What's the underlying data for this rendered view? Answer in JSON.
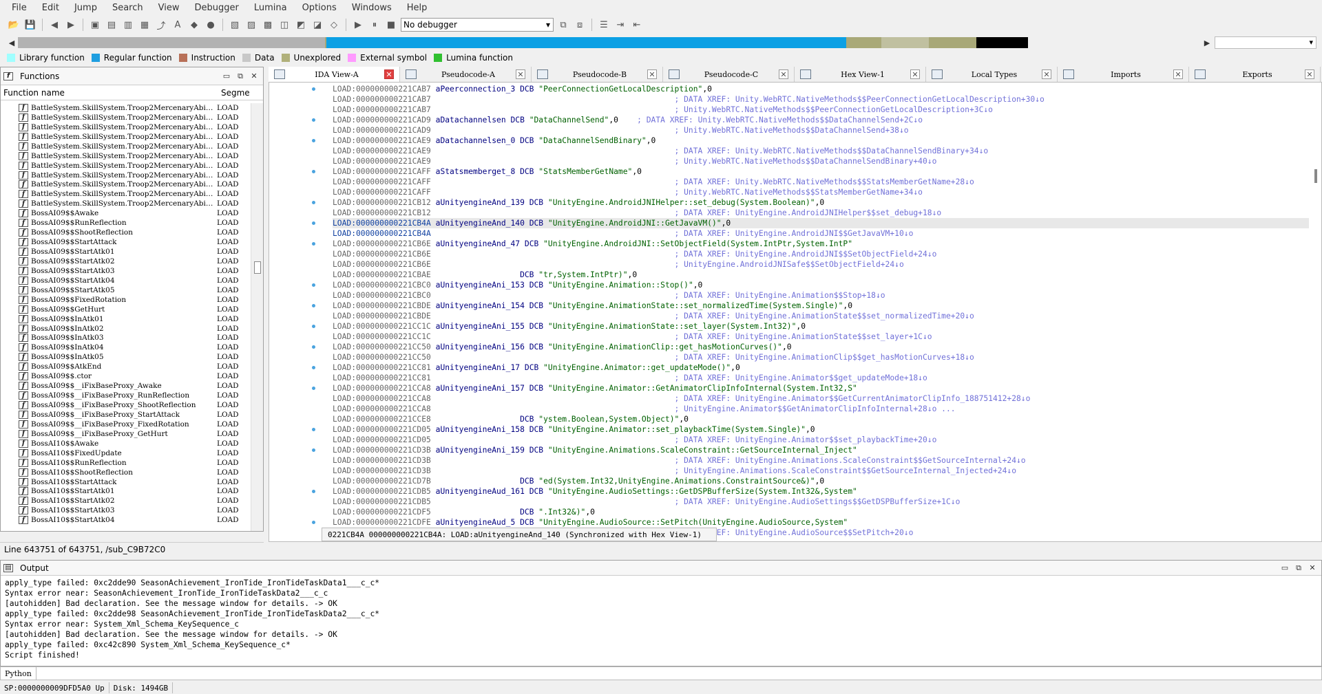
{
  "menu": [
    "File",
    "Edit",
    "Jump",
    "Search",
    "View",
    "Debugger",
    "Lumina",
    "Options",
    "Windows",
    "Help"
  ],
  "toolbar": {
    "debugger_select": "No debugger"
  },
  "navbar_segments": [
    {
      "color": "#b2b2b2",
      "frac": 0.26
    },
    {
      "color": "#a8a878",
      "frac": 0.001
    },
    {
      "color": "#0ca0e4",
      "frac": 0.44
    },
    {
      "color": "#a9a978",
      "frac": 0.03
    },
    {
      "color": "#c0c0a0",
      "frac": 0.04
    },
    {
      "color": "#a8a878",
      "frac": 0.04
    },
    {
      "color": "#000000",
      "frac": 0.044
    }
  ],
  "legend": [
    {
      "label": "Library function",
      "color": "#a0ffff"
    },
    {
      "label": "Regular function",
      "color": "#1e9ee0"
    },
    {
      "label": "Instruction",
      "color": "#b87058"
    },
    {
      "label": "Data",
      "color": "#c8c8c8"
    },
    {
      "label": "Unexplored",
      "color": "#b0b07a"
    },
    {
      "label": "External symbol",
      "color": "#ff9aff"
    },
    {
      "label": "Lumina function",
      "color": "#30c030"
    }
  ],
  "functions": {
    "title": "Functions",
    "col_name": "Function name",
    "col_segment": "Segme",
    "rows": [
      {
        "name": "BattleSystem.SkillSystem.Troop2MercenaryAbi…",
        "seg": "LOAD"
      },
      {
        "name": "BattleSystem.SkillSystem.Troop2MercenaryAbi…",
        "seg": "LOAD"
      },
      {
        "name": "BattleSystem.SkillSystem.Troop2MercenaryAbi…",
        "seg": "LOAD"
      },
      {
        "name": "BattleSystem.SkillSystem.Troop2MercenaryAbi…",
        "seg": "LOAD"
      },
      {
        "name": "BattleSystem.SkillSystem.Troop2MercenaryAbi…",
        "seg": "LOAD"
      },
      {
        "name": "BattleSystem.SkillSystem.Troop2MercenaryAbi…",
        "seg": "LOAD"
      },
      {
        "name": "BattleSystem.SkillSystem.Troop2MercenaryAbi…",
        "seg": "LOAD"
      },
      {
        "name": "BattleSystem.SkillSystem.Troop2MercenaryAbi…",
        "seg": "LOAD"
      },
      {
        "name": "BattleSystem.SkillSystem.Troop2MercenaryAbi…",
        "seg": "LOAD"
      },
      {
        "name": "BattleSystem.SkillSystem.Troop2MercenaryAbi…",
        "seg": "LOAD"
      },
      {
        "name": "BattleSystem.SkillSystem.Troop2MercenaryAbi…",
        "seg": "LOAD"
      },
      {
        "name": "BossAI09$$Awake",
        "seg": "LOAD"
      },
      {
        "name": "BossAI09$$RunReflection",
        "seg": "LOAD"
      },
      {
        "name": "BossAI09$$ShootReflection",
        "seg": "LOAD"
      },
      {
        "name": "BossAI09$$StartAttack",
        "seg": "LOAD"
      },
      {
        "name": "BossAI09$$StartAtk01",
        "seg": "LOAD"
      },
      {
        "name": "BossAI09$$StartAtk02",
        "seg": "LOAD"
      },
      {
        "name": "BossAI09$$StartAtk03",
        "seg": "LOAD"
      },
      {
        "name": "BossAI09$$StartAtk04",
        "seg": "LOAD"
      },
      {
        "name": "BossAI09$$StartAtk05",
        "seg": "LOAD"
      },
      {
        "name": "BossAI09$$FixedRotation",
        "seg": "LOAD"
      },
      {
        "name": "BossAI09$$GetHurt",
        "seg": "LOAD"
      },
      {
        "name": "BossAI09$$InAtk01",
        "seg": "LOAD"
      },
      {
        "name": "BossAI09$$InAtk02",
        "seg": "LOAD"
      },
      {
        "name": "BossAI09$$InAtk03",
        "seg": "LOAD"
      },
      {
        "name": "BossAI09$$InAtk04",
        "seg": "LOAD"
      },
      {
        "name": "BossAI09$$InAtk05",
        "seg": "LOAD"
      },
      {
        "name": "BossAI09$$AtkEnd",
        "seg": "LOAD"
      },
      {
        "name": "BossAI09$$.ctor",
        "seg": "LOAD"
      },
      {
        "name": "BossAI09$$__iFixBaseProxy_Awake",
        "seg": "LOAD"
      },
      {
        "name": "BossAI09$$__iFixBaseProxy_RunReflection",
        "seg": "LOAD"
      },
      {
        "name": "BossAI09$$__iFixBaseProxy_ShootReflection",
        "seg": "LOAD"
      },
      {
        "name": "BossAI09$$__iFixBaseProxy_StartAttack",
        "seg": "LOAD"
      },
      {
        "name": "BossAI09$$__iFixBaseProxy_FixedRotation",
        "seg": "LOAD"
      },
      {
        "name": "BossAI09$$__iFixBaseProxy_GetHurt",
        "seg": "LOAD"
      },
      {
        "name": "BossAI10$$Awake",
        "seg": "LOAD"
      },
      {
        "name": "BossAI10$$FixedUpdate",
        "seg": "LOAD"
      },
      {
        "name": "BossAI10$$RunReflection",
        "seg": "LOAD"
      },
      {
        "name": "BossAI10$$ShootReflection",
        "seg": "LOAD"
      },
      {
        "name": "BossAI10$$StartAttack",
        "seg": "LOAD"
      },
      {
        "name": "BossAI10$$StartAtk01",
        "seg": "LOAD"
      },
      {
        "name": "BossAI10$$StartAtk02",
        "seg": "LOAD"
      },
      {
        "name": "BossAI10$$StartAtk03",
        "seg": "LOAD"
      },
      {
        "name": "BossAI10$$StartAtk04",
        "seg": "LOAD"
      }
    ],
    "line_info": "Line 643751 of 643751, /sub_C9B72C0"
  },
  "tabs": [
    {
      "label": "IDA View-A",
      "active": true
    },
    {
      "label": "Pseudocode-A",
      "active": false
    },
    {
      "label": "Pseudocode-B",
      "active": false
    },
    {
      "label": "Pseudocode-C",
      "active": false
    },
    {
      "label": "Hex View-1",
      "active": false
    },
    {
      "label": "Local Types",
      "active": false
    },
    {
      "label": "Imports",
      "active": false
    },
    {
      "label": "Exports",
      "active": false
    }
  ],
  "disasm": {
    "lines": [
      {
        "addr": "LOAD:000000000221CAB7",
        "name": "aPeerconnection_3",
        "op": "DCB",
        "str": "\"PeerConnectionGetLocalDescription\"",
        "tail": ",0",
        "cm": "",
        "dot": true
      },
      {
        "addr": "LOAD:000000000221CAB7",
        "name": "",
        "op": "",
        "str": "",
        "tail": "",
        "cm": "; DATA XREF: Unity.WebRTC.NativeMethods$$PeerConnectionGetLocalDescription+30↓o",
        "dot": false
      },
      {
        "addr": "LOAD:000000000221CAB7",
        "name": "",
        "op": "",
        "str": "",
        "tail": "",
        "cm": "; Unity.WebRTC.NativeMethods$$PeerConnectionGetLocalDescription+3C↓o",
        "dot": false
      },
      {
        "addr": "LOAD:000000000221CAD9",
        "name": "aDatachannelsen",
        "op": "DCB",
        "str": "\"DataChannelSend\"",
        "tail": ",0",
        "cm": "; DATA XREF: Unity.WebRTC.NativeMethods$$DataChannelSend+2C↓o",
        "dot": true
      },
      {
        "addr": "LOAD:000000000221CAD9",
        "name": "",
        "op": "",
        "str": "",
        "tail": "",
        "cm": "; Unity.WebRTC.NativeMethods$$DataChannelSend+38↓o",
        "dot": false
      },
      {
        "addr": "LOAD:000000000221CAE9",
        "name": "aDatachannelsen_0",
        "op": "DCB",
        "str": "\"DataChannelSendBinary\"",
        "tail": ",0",
        "cm": "",
        "dot": true
      },
      {
        "addr": "LOAD:000000000221CAE9",
        "name": "",
        "op": "",
        "str": "",
        "tail": "",
        "cm": "; DATA XREF: Unity.WebRTC.NativeMethods$$DataChannelSendBinary+34↓o",
        "dot": false
      },
      {
        "addr": "LOAD:000000000221CAE9",
        "name": "",
        "op": "",
        "str": "",
        "tail": "",
        "cm": "; Unity.WebRTC.NativeMethods$$DataChannelSendBinary+40↓o",
        "dot": false
      },
      {
        "addr": "LOAD:000000000221CAFF",
        "name": "aStatsmemberget_8",
        "op": "DCB",
        "str": "\"StatsMemberGetName\"",
        "tail": ",0",
        "cm": "",
        "dot": true
      },
      {
        "addr": "LOAD:000000000221CAFF",
        "name": "",
        "op": "",
        "str": "",
        "tail": "",
        "cm": "; DATA XREF: Unity.WebRTC.NativeMethods$$StatsMemberGetName+28↓o",
        "dot": false
      },
      {
        "addr": "LOAD:000000000221CAFF",
        "name": "",
        "op": "",
        "str": "",
        "tail": "",
        "cm": "; Unity.WebRTC.NativeMethods$$StatsMemberGetName+34↓o",
        "dot": false
      },
      {
        "addr": "LOAD:000000000221CB12",
        "name": "aUnityengineAnd_139",
        "op": "DCB",
        "str": "\"UnityEngine.AndroidJNIHelper::set_debug(System.Boolean)\"",
        "tail": ",0",
        "cm": "",
        "dot": true
      },
      {
        "addr": "LOAD:000000000221CB12",
        "name": "",
        "op": "",
        "str": "",
        "tail": "",
        "cm": "; DATA XREF: UnityEngine.AndroidJNIHelper$$set_debug+18↓o",
        "dot": false
      },
      {
        "addr": "LOAD:000000000221CB4A",
        "name": "aUnityengineAnd_140",
        "op": "DCB",
        "str": "\"UnityEngine.AndroidJNI::GetJavaVM()\"",
        "tail": ",0",
        "cm": "",
        "dot": true,
        "hl": true,
        "blue": true
      },
      {
        "addr": "LOAD:000000000221CB4A",
        "name": "",
        "op": "",
        "str": "",
        "tail": "",
        "cm": "; DATA XREF: UnityEngine.AndroidJNI$$GetJavaVM+10↓o",
        "dot": false,
        "blue": true
      },
      {
        "addr": "LOAD:000000000221CB6E",
        "name": "aUnityengineAnd_47",
        "op": "DCB",
        "str": "\"UnityEngine.AndroidJNI::SetObjectField(System.IntPtr,System.IntP\"",
        "tail": "",
        "cm": "",
        "dot": true
      },
      {
        "addr": "LOAD:000000000221CB6E",
        "name": "",
        "op": "",
        "str": "",
        "tail": "",
        "cm": "; DATA XREF: UnityEngine.AndroidJNI$$SetObjectField+24↓o",
        "dot": false
      },
      {
        "addr": "LOAD:000000000221CB6E",
        "name": "",
        "op": "",
        "str": "",
        "tail": "",
        "cm": "; UnityEngine.AndroidJNISafe$$SetObjectField+24↓o",
        "dot": false
      },
      {
        "addr": "LOAD:000000000221CBAE",
        "name": "",
        "op": "DCB",
        "str": "\"tr,System.IntPtr)\"",
        "tail": ",0",
        "cm": "",
        "dot": false,
        "cont": true
      },
      {
        "addr": "LOAD:000000000221CBC0",
        "name": "aUnityengineAni_153",
        "op": "DCB",
        "str": "\"UnityEngine.Animation::Stop()\"",
        "tail": ",0",
        "cm": "",
        "dot": true
      },
      {
        "addr": "LOAD:000000000221CBC0",
        "name": "",
        "op": "",
        "str": "",
        "tail": "",
        "cm": "; DATA XREF: UnityEngine.Animation$$Stop+18↓o",
        "dot": false
      },
      {
        "addr": "LOAD:000000000221CBDE",
        "name": "aUnityengineAni_154",
        "op": "DCB",
        "str": "\"UnityEngine.AnimationState::set_normalizedTime(System.Single)\"",
        "tail": ",0",
        "cm": "",
        "dot": true
      },
      {
        "addr": "LOAD:000000000221CBDE",
        "name": "",
        "op": "",
        "str": "",
        "tail": "",
        "cm": "; DATA XREF: UnityEngine.AnimationState$$set_normalizedTime+20↓o",
        "dot": false
      },
      {
        "addr": "LOAD:000000000221CC1C",
        "name": "aUnityengineAni_155",
        "op": "DCB",
        "str": "\"UnityEngine.AnimationState::set_layer(System.Int32)\"",
        "tail": ",0",
        "cm": "",
        "dot": true
      },
      {
        "addr": "LOAD:000000000221CC1C",
        "name": "",
        "op": "",
        "str": "",
        "tail": "",
        "cm": "; DATA XREF: UnityEngine.AnimationState$$set_layer+1C↓o",
        "dot": false
      },
      {
        "addr": "LOAD:000000000221CC50",
        "name": "aUnityengineAni_156",
        "op": "DCB",
        "str": "\"UnityEngine.AnimationClip::get_hasMotionCurves()\"",
        "tail": ",0",
        "cm": "",
        "dot": true
      },
      {
        "addr": "LOAD:000000000221CC50",
        "name": "",
        "op": "",
        "str": "",
        "tail": "",
        "cm": "; DATA XREF: UnityEngine.AnimationClip$$get_hasMotionCurves+18↓o",
        "dot": false
      },
      {
        "addr": "LOAD:000000000221CC81",
        "name": "aUnityengineAni_17",
        "op": "DCB",
        "str": "\"UnityEngine.Animator::get_updateMode()\"",
        "tail": ",0",
        "cm": "",
        "dot": true
      },
      {
        "addr": "LOAD:000000000221CC81",
        "name": "",
        "op": "",
        "str": "",
        "tail": "",
        "cm": "; DATA XREF: UnityEngine.Animator$$get_updateMode+18↓o",
        "dot": false
      },
      {
        "addr": "LOAD:000000000221CCA8",
        "name": "aUnityengineAni_157",
        "op": "DCB",
        "str": "\"UnityEngine.Animator::GetAnimatorClipInfoInternal(System.Int32,S\"",
        "tail": "",
        "cm": "",
        "dot": true
      },
      {
        "addr": "LOAD:000000000221CCA8",
        "name": "",
        "op": "",
        "str": "",
        "tail": "",
        "cm": "; DATA XREF: UnityEngine.Animator$$GetCurrentAnimatorClipInfo_188751412+28↓o",
        "dot": false
      },
      {
        "addr": "LOAD:000000000221CCA8",
        "name": "",
        "op": "",
        "str": "",
        "tail": "",
        "cm": "; UnityEngine.Animator$$GetAnimatorClipInfoInternal+28↓o ...",
        "dot": false
      },
      {
        "addr": "LOAD:000000000221CCE8",
        "name": "",
        "op": "DCB",
        "str": "\"ystem.Boolean,System.Object)\"",
        "tail": ",0",
        "cm": "",
        "dot": false,
        "cont": true
      },
      {
        "addr": "LOAD:000000000221CD05",
        "name": "aUnityengineAni_158",
        "op": "DCB",
        "str": "\"UnityEngine.Animator::set_playbackTime(System.Single)\"",
        "tail": ",0",
        "cm": "",
        "dot": true
      },
      {
        "addr": "LOAD:000000000221CD05",
        "name": "",
        "op": "",
        "str": "",
        "tail": "",
        "cm": "; DATA XREF: UnityEngine.Animator$$set_playbackTime+20↓o",
        "dot": false
      },
      {
        "addr": "LOAD:000000000221CD3B",
        "name": "aUnityengineAni_159",
        "op": "DCB",
        "str": "\"UnityEngine.Animations.ScaleConstraint::GetSourceInternal_Inject\"",
        "tail": "",
        "cm": "",
        "dot": true
      },
      {
        "addr": "LOAD:000000000221CD3B",
        "name": "",
        "op": "",
        "str": "",
        "tail": "",
        "cm": "; DATA XREF: UnityEngine.Animations.ScaleConstraint$$GetSourceInternal+24↓o",
        "dot": false
      },
      {
        "addr": "LOAD:000000000221CD3B",
        "name": "",
        "op": "",
        "str": "",
        "tail": "",
        "cm": "; UnityEngine.Animations.ScaleConstraint$$GetSourceInternal_Injected+24↓o",
        "dot": false
      },
      {
        "addr": "LOAD:000000000221CD7B",
        "name": "",
        "op": "DCB",
        "str": "\"ed(System.Int32,UnityEngine.Animations.ConstraintSource&)\"",
        "tail": ",0",
        "cm": "",
        "dot": false,
        "cont": true
      },
      {
        "addr": "LOAD:000000000221CDB5",
        "name": "aUnityengineAud_161",
        "op": "DCB",
        "str": "\"UnityEngine.AudioSettings::GetDSPBufferSize(System.Int32&,System\"",
        "tail": "",
        "cm": "",
        "dot": true
      },
      {
        "addr": "LOAD:000000000221CDB5",
        "name": "",
        "op": "",
        "str": "",
        "tail": "",
        "cm": "; DATA XREF: UnityEngine.AudioSettings$$GetDSPBufferSize+1C↓o",
        "dot": false
      },
      {
        "addr": "LOAD:000000000221CDF5",
        "name": "",
        "op": "DCB",
        "str": "\".Int32&)\"",
        "tail": ",0",
        "cm": "",
        "dot": false,
        "cont": true
      },
      {
        "addr": "LOAD:000000000221CDFE",
        "name": "aUnityengineAud_5",
        "op": "DCB",
        "str": "\"UnityEngine.AudioSource::SetPitch(UnityEngine.AudioSource,System\"",
        "tail": "",
        "cm": "",
        "dot": true
      },
      {
        "addr": "LOAD:000000000221CDFE",
        "name": "",
        "op": "",
        "str": "",
        "tail": "",
        "cm": "; DATA XREF: UnityEngine.AudioSource$$SetPitch+20↓o",
        "dot": false
      }
    ],
    "status": "0221CB4A 000000000221CB4A: LOAD:aUnityengineAnd_140 (Synchronized with Hex View-1)"
  },
  "output": {
    "title": "Output",
    "lines": [
      "apply_type failed: 0xc2dde90 SeasonAchievement_IronTide_IronTideTaskData1___c_c*",
      "Syntax error near: SeasonAchievement_IronTide_IronTideTaskData2___c_c",
      "[autohidden] Bad declaration. See the message window for details. -> OK",
      "apply_type failed: 0xc2dde98 SeasonAchievement_IronTide_IronTideTaskData2___c_c*",
      "Syntax error near: System_Xml_Schema_KeySequence_c",
      "[autohidden] Bad declaration. See the message window for details. -> OK",
      "apply_type failed: 0xc42c890 System_Xml_Schema_KeySequence_c*",
      "Script finished!"
    ],
    "python_button": "Python"
  },
  "statusbar": {
    "sp": "SP:0000000009DFD5A0 Up",
    "disk": "Disk: 1494GB"
  }
}
